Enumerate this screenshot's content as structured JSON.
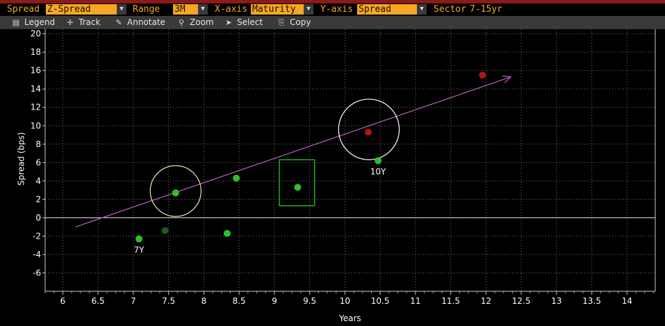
{
  "params": {
    "spread_label": "Spread",
    "spread_value": "Z-Spread",
    "range_label": "Range",
    "range_value": "3M",
    "xaxis_label": "X-axis",
    "xaxis_value": "Maturity",
    "yaxis_label": "Y-axis",
    "yaxis_value": "Spread",
    "sector_label": "Sector",
    "sector_value": "7-15yr"
  },
  "toolbar": {
    "legend": "Legend",
    "track": "Track",
    "annotate": "Annotate",
    "zoom": "Zoom",
    "select": "Select",
    "copy": "Copy"
  },
  "chart_data": {
    "type": "scatter",
    "xlabel": "Years",
    "ylabel": "Spread (bps)",
    "xlim": [
      5.75,
      14.4
    ],
    "ylim": [
      -8,
      20.5
    ],
    "x_ticks": [
      "6",
      "6.5",
      "7",
      "7.5",
      "8",
      "8.5",
      "9",
      "9.5",
      "10",
      "10.5",
      "11",
      "11.5",
      "12",
      "12.5",
      "13",
      "13.5",
      "14"
    ],
    "y_ticks": [
      "20",
      "18",
      "16",
      "14",
      "12",
      "10",
      "8",
      "6",
      "4",
      "2",
      "0",
      "-2",
      "-4",
      "-6"
    ],
    "points": [
      {
        "x": 7.08,
        "y": -2.3,
        "color": "#2dbf2d",
        "label": "7Y"
      },
      {
        "x": 7.45,
        "y": -1.4,
        "color": "#1f5a1f",
        "label": ""
      },
      {
        "x": 7.6,
        "y": 2.7,
        "color": "#2dbf2d",
        "label": ""
      },
      {
        "x": 8.33,
        "y": -1.7,
        "color": "#2dbf2d",
        "label": ""
      },
      {
        "x": 8.46,
        "y": 4.3,
        "color": "#2dbf2d",
        "label": ""
      },
      {
        "x": 9.33,
        "y": 3.3,
        "color": "#2dbf2d",
        "label": ""
      },
      {
        "x": 10.47,
        "y": 6.2,
        "color": "#2dbf2d",
        "label": "10Y"
      },
      {
        "x": 10.33,
        "y": 9.3,
        "color": "#b01414",
        "label": ""
      },
      {
        "x": 11.95,
        "y": 15.5,
        "color": "#b01414",
        "label": ""
      }
    ],
    "trend": {
      "x1": 6.18,
      "y1": -1.0,
      "x2": 12.35,
      "y2": 15.3,
      "color": "#c060c0"
    },
    "circles": [
      {
        "x": 7.6,
        "y": 2.9,
        "rx_years": 0.36,
        "color": "#e8e8b0"
      },
      {
        "x": 10.34,
        "y": 9.6,
        "rx_years": 0.43,
        "color": "#ffffff"
      }
    ],
    "boxes": [
      {
        "x1": 9.07,
        "x2": 9.57,
        "y1": 1.3,
        "y2": 6.3,
        "color": "#22dd22"
      }
    ],
    "grid": true,
    "zero_line": true
  }
}
